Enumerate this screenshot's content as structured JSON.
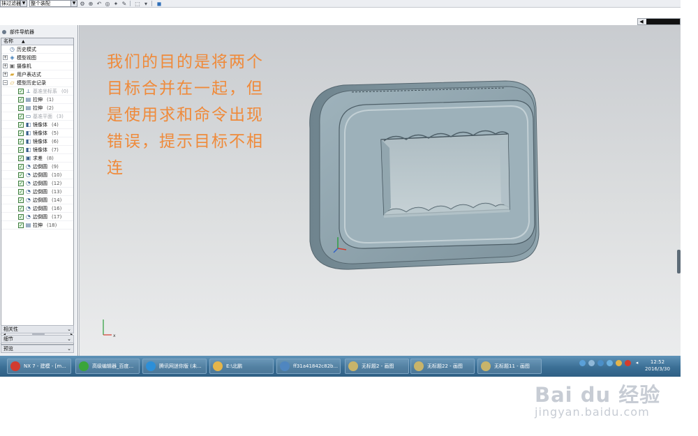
{
  "toolbar": {
    "filter_label": "抹过滤器",
    "assembly_scope": "整个装配"
  },
  "navigator": {
    "title": "部件导航器",
    "column_header": "名称",
    "sort_indicator": "▲",
    "top_items": [
      {
        "label": "历史模式",
        "icon": "clock-icon",
        "expander": false
      },
      {
        "label": "模型视图",
        "icon": "model-views-icon",
        "expander": true
      },
      {
        "label": "摄像机",
        "icon": "camera-icon",
        "expander": true
      },
      {
        "label": "用户表达式",
        "icon": "folder-icon",
        "expander": true
      },
      {
        "label": "模型历史记录",
        "icon": "folder-open-icon",
        "expander": true
      }
    ],
    "features": [
      {
        "label": "基准坐标系",
        "num": "(0)",
        "greyed": true,
        "icon": "datum-csys-icon"
      },
      {
        "label": "拉伸",
        "num": "(1)",
        "greyed": false,
        "icon": "extrude-icon"
      },
      {
        "label": "拉伸",
        "num": "(2)",
        "greyed": false,
        "icon": "extrude-icon"
      },
      {
        "label": "基准平面",
        "num": "(3)",
        "greyed": true,
        "icon": "datum-plane-icon"
      },
      {
        "label": "镜像体",
        "num": "(4)",
        "greyed": false,
        "icon": "mirror-body-icon"
      },
      {
        "label": "镜像体",
        "num": "(5)",
        "greyed": false,
        "icon": "mirror-body-icon"
      },
      {
        "label": "镜像体",
        "num": "(6)",
        "greyed": false,
        "icon": "mirror-body-icon"
      },
      {
        "label": "镜像体",
        "num": "(7)",
        "greyed": false,
        "icon": "mirror-body-icon"
      },
      {
        "label": "求差",
        "num": "(8)",
        "greyed": false,
        "icon": "subtract-icon"
      },
      {
        "label": "边倒圆",
        "num": "(9)",
        "greyed": false,
        "icon": "edge-blend-icon"
      },
      {
        "label": "边倒圆",
        "num": "(10)",
        "greyed": false,
        "icon": "edge-blend-icon"
      },
      {
        "label": "边倒圆",
        "num": "(12)",
        "greyed": false,
        "icon": "edge-blend-icon"
      },
      {
        "label": "边倒圆",
        "num": "(13)",
        "greyed": false,
        "icon": "edge-blend-icon"
      },
      {
        "label": "边倒圆",
        "num": "(14)",
        "greyed": false,
        "icon": "edge-blend-icon"
      },
      {
        "label": "边倒圆",
        "num": "(16)",
        "greyed": false,
        "icon": "edge-blend-icon"
      },
      {
        "label": "边倒圆",
        "num": "(17)",
        "greyed": false,
        "icon": "edge-blend-icon"
      },
      {
        "label": "拉伸",
        "num": "(18)",
        "greyed": false,
        "icon": "extrude-icon"
      }
    ],
    "sections": [
      {
        "label": "相关性"
      },
      {
        "label": "细节"
      },
      {
        "label": "预览"
      }
    ]
  },
  "annotation": {
    "lines": [
      "我们的目的是将两个",
      "目标合并在一起，但",
      "是使用求和命令出现",
      "错误，提示目标不相",
      "连"
    ]
  },
  "taskbar": {
    "items": [
      {
        "label": "NX 7 - 建模 - [m...",
        "color": "#d23b2f"
      },
      {
        "label": "高级编辑器_百度...",
        "color": "#3aa53a"
      },
      {
        "label": "腾讯网迷你版 (未...",
        "color": "#2d8fd8"
      },
      {
        "label": "E:\\北鹏",
        "color": "#e4b54a"
      },
      {
        "label": "ff31a41842c82b...",
        "color": "#4f86c0"
      },
      {
        "label": "无标题2 - 画图",
        "color": "#c8b46a"
      },
      {
        "label": "无标题22 - 画图",
        "color": "#c8b46a"
      },
      {
        "label": "无标题11 - 画图",
        "color": "#c8b46a"
      }
    ],
    "clock_time": "12:52",
    "clock_date": "2016/3/30"
  },
  "watermark": {
    "logo": "Bai du 经验",
    "url": "jingyan.baidu.com"
  },
  "colors": {
    "annotation": "#ef8a3a",
    "model_body": "#8ea4ae",
    "taskbar": "#3b6f95"
  }
}
